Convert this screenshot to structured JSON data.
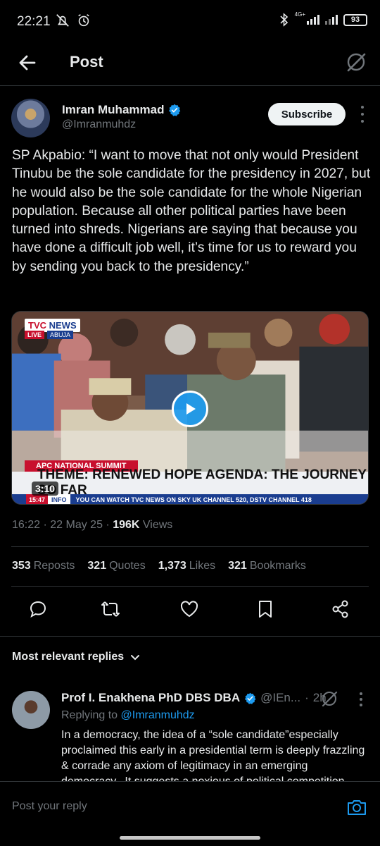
{
  "status_bar": {
    "time": "22:21",
    "network": "4G+",
    "battery": "93"
  },
  "header": {
    "title": "Post"
  },
  "post": {
    "author": {
      "name": "Imran Muhammad",
      "handle": "@Imranmuhdz",
      "verified": true
    },
    "subscribe_label": "Subscribe",
    "text": "SP Akpabio: “I want to move that not only would President Tinubu be the sole candidate for the presidency in 2027, but he would also be the sole candidate for the whole Nigerian population. Because all other political parties have been turned into shreds. Nigerians are saying that because you have done a difficult job well, it’s time for us to reward you by sending you back to the presidency.”",
    "media": {
      "channel_logo_tvc": "TVC",
      "channel_logo_news": "NEWS",
      "live_tag": "LIVE",
      "location_tag": "ABUJA",
      "event_band": "APC NATIONAL SUMMIT",
      "theme_band": "THEME: RENEWED HOPE AGENDA: THE JOURNEY SO FAR",
      "ticker_time": "15:47",
      "ticker_info": "INFO",
      "ticker_text": "YOU CAN WATCH TVC NEWS ON SKY UK CHANNEL 520, DSTV CHANNEL 418",
      "duration": "3:10"
    },
    "time": "16:22",
    "date": "22 May 25",
    "views_count": "196K",
    "views_label": "Views",
    "stats": {
      "reposts_count": "353",
      "reposts_label": "Reposts",
      "quotes_count": "321",
      "quotes_label": "Quotes",
      "likes_count": "1,373",
      "likes_label": "Likes",
      "bookmarks_count": "321",
      "bookmarks_label": "Bookmarks"
    }
  },
  "replies": {
    "sort_label": "Most relevant replies",
    "items": [
      {
        "name": "Prof I. Enakhena PhD DBS DBA",
        "handle": "@IEn...",
        "time": "2h",
        "replying_to_label": "Replying to",
        "replying_to_handle": "@Imranmuhdz",
        "text": "In a democracy, the idea of a “sole candidate”especially proclaimed this early in a presidential term is deeply frazzling & corrade any axiom of legitimacy in an emerging democracy.. It suggests a noxious of political competition"
      }
    ]
  },
  "compose": {
    "placeholder": "Post your reply"
  },
  "colors": {
    "accent": "#1d9bf0",
    "background": "#000000",
    "muted": "#71767b"
  }
}
